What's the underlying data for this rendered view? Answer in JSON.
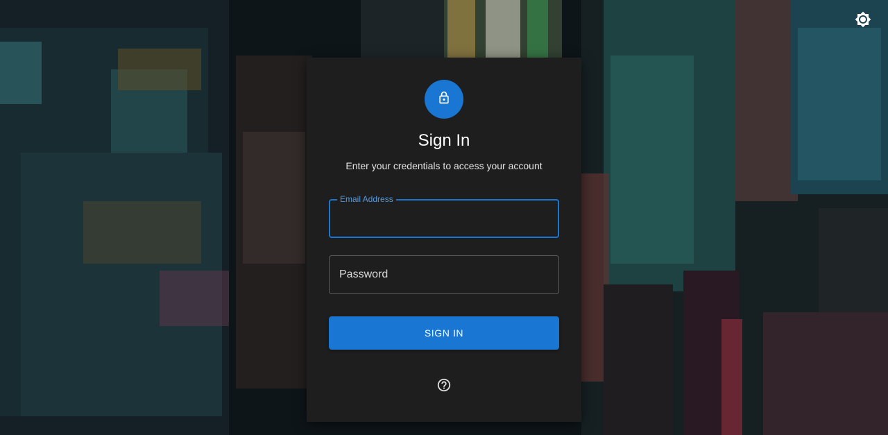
{
  "header": {
    "theme_toggle_icon": "brightness-gear-icon"
  },
  "login": {
    "icon": "lock-icon",
    "title": "Sign In",
    "subtitle": "Enter your credentials to access your account",
    "email": {
      "label": "Email Address",
      "value": ""
    },
    "password": {
      "placeholder": "Password",
      "value": ""
    },
    "submit_label": "SIGN IN",
    "help_icon": "help-circle-icon"
  },
  "colors": {
    "accent": "#1976d2",
    "card_background": "#1e1e1e",
    "label_accent": "#4e9ae4"
  }
}
